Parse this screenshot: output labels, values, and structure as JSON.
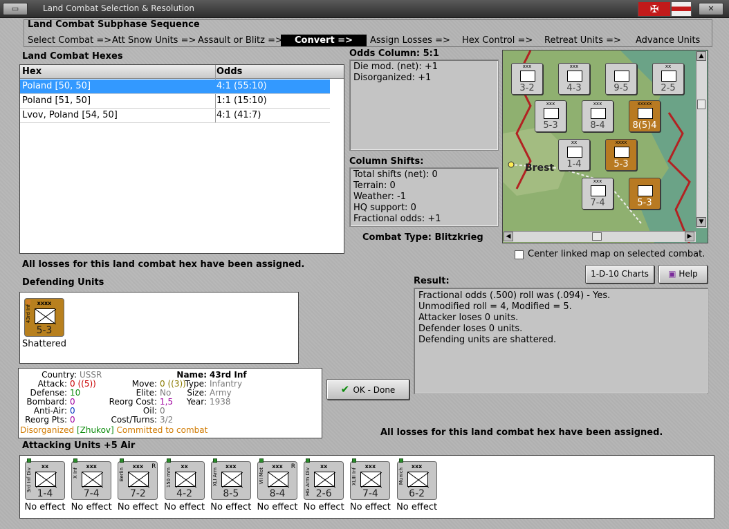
{
  "window": {
    "title": "Land Combat Selection & Resolution",
    "accent": "#3399ff",
    "icons": [
      "restore-icon",
      "close-icon",
      "flag-icon"
    ]
  },
  "sequence": {
    "title": "Land Combat Subphase Sequence",
    "steps": [
      "Select Combat =>",
      "Att Snow Units =>",
      "Assault or Blitz =>",
      "Convert =>",
      "Assign Losses =>",
      "Hex Control =>",
      "Retreat Units =>",
      "Advance Units"
    ],
    "active_index": 3
  },
  "hexes": {
    "title": "Land Combat Hexes",
    "columns": [
      "Hex",
      "Odds"
    ],
    "rows": [
      {
        "hex": "Poland [50, 50]",
        "odds": "4:1 (55:10)"
      },
      {
        "hex": "Poland [51, 50]",
        "odds": "1:1 (15:10)"
      },
      {
        "hex": "Lvov, Poland [54, 50]",
        "odds": "4:1 (41:7)"
      }
    ],
    "selected_index": 0
  },
  "odds": {
    "title": "Odds Column: 5:1",
    "lines": [
      "Die mod. (net): +1",
      "Disorganized: +1"
    ]
  },
  "shifts": {
    "title": "Column Shifts:",
    "lines": [
      "Total shifts (net): 0",
      "Terrain: 0",
      "Weather: -1",
      "HQ support: 0",
      "Fractional odds: +1"
    ]
  },
  "combat_type": "Combat Type:  Blitzkrieg",
  "map": {
    "city_label": "Brest",
    "counters": [
      {
        "size": "xxx",
        "value": "3-2",
        "color": "gray"
      },
      {
        "size": "xxx",
        "value": "4-3",
        "color": "gray"
      },
      {
        "size": "",
        "value": "9-5",
        "color": "gray"
      },
      {
        "size": "xx",
        "value": "2-5",
        "color": "gray"
      },
      {
        "size": "xxx",
        "value": "5-3",
        "color": "gray"
      },
      {
        "size": "xxx",
        "value": "8-4",
        "color": "gray"
      },
      {
        "size": "xxxxx",
        "value": "8(5)4",
        "color": "orange"
      },
      {
        "size": "xx",
        "value": "1-4",
        "color": "gray"
      },
      {
        "size": "xxxx",
        "value": "5-3",
        "color": "orange"
      },
      {
        "size": "xxx",
        "value": "7-4",
        "color": "gray"
      },
      {
        "size": "",
        "value": "5-3",
        "color": "orange"
      }
    ],
    "terrain_color": "#8fb070",
    "border_color": "#b22222"
  },
  "center_map": "Center linked map on selected combat.",
  "buttons": {
    "charts": "1-D-10 Charts",
    "help": "Help",
    "ok": "OK - Done"
  },
  "losses_msg": "All losses for this land combat hex have been assigned.",
  "defending": {
    "title": "Defending Units",
    "units": [
      {
        "name": "43rd Inf",
        "size": "xxxx",
        "value": "5-3",
        "status": "Shattered"
      }
    ]
  },
  "result": {
    "title": "Result:",
    "lines": [
      "Fractional odds (.500) roll was (.094)  - Yes.",
      "Unmodified roll = 4, Modified = 5.",
      "Attacker loses 0 units.",
      "Defender loses 0 units.",
      "Defending units are shattered."
    ]
  },
  "info": {
    "country_k": "Country:",
    "country_v": "USSR",
    "attack_k": "Attack:",
    "attack_v": "0",
    "attack_v2": "(5)",
    "defense_k": "Defense:",
    "defense_v": "10",
    "bombard_k": "Bombard:",
    "bombard_v": "0",
    "antiair_k": "Anti-Air:",
    "antiair_v": "0",
    "reorgpts_k": "Reorg Pts:",
    "reorgpts_v": "0",
    "move_k": "Move:",
    "move_v": "0",
    "move_v2": "(3)",
    "elite_k": "Elite:",
    "elite_v": "No",
    "reorgcost_k": "Reorg Cost:",
    "reorgcost_v": "1,5",
    "oil_k": "Oil:",
    "oil_v": "0",
    "cost_k": "Cost/Turns:",
    "cost_v": "3/2",
    "name_k": "Name:",
    "name_v": "43rd Inf",
    "type_k": "Type:",
    "type_v": "Infantry",
    "size_k": "Size:",
    "size_v": "Army",
    "year_k": "Year:",
    "year_v": "1938",
    "disorg": "Disorganized",
    "commander": "[Zhukov]",
    "committed": "Committed to combat"
  },
  "attacking": {
    "title": "Attacking Units +5 Air",
    "units": [
      {
        "name": "3rd Inf Div",
        "size": "xx",
        "value": "1-4",
        "status": "No effect",
        "reserve": ""
      },
      {
        "name": "X Inf",
        "size": "xxx",
        "value": "7-4",
        "status": "No effect",
        "reserve": ""
      },
      {
        "name": "Berlin",
        "size": "xxx",
        "value": "7-2",
        "status": "No effect",
        "reserve": "R"
      },
      {
        "name": "150 mm",
        "size": "xx",
        "value": "4-2",
        "status": "No effect",
        "reserve": ""
      },
      {
        "name": "XLI Arm",
        "size": "xxx",
        "value": "8-5",
        "status": "No effect",
        "reserve": ""
      },
      {
        "name": "VII Mot",
        "size": "xxx",
        "value": "8-4",
        "status": "No effect",
        "reserve": "R"
      },
      {
        "name": "HG Arm Div",
        "size": "xx",
        "value": "2-6",
        "status": "No effect",
        "reserve": ""
      },
      {
        "name": "XLIII Inf",
        "size": "xxx",
        "value": "7-4",
        "status": "No effect",
        "reserve": ""
      },
      {
        "name": "Munich",
        "size": "xxx",
        "value": "6-2",
        "status": "No effect",
        "reserve": ""
      }
    ]
  }
}
